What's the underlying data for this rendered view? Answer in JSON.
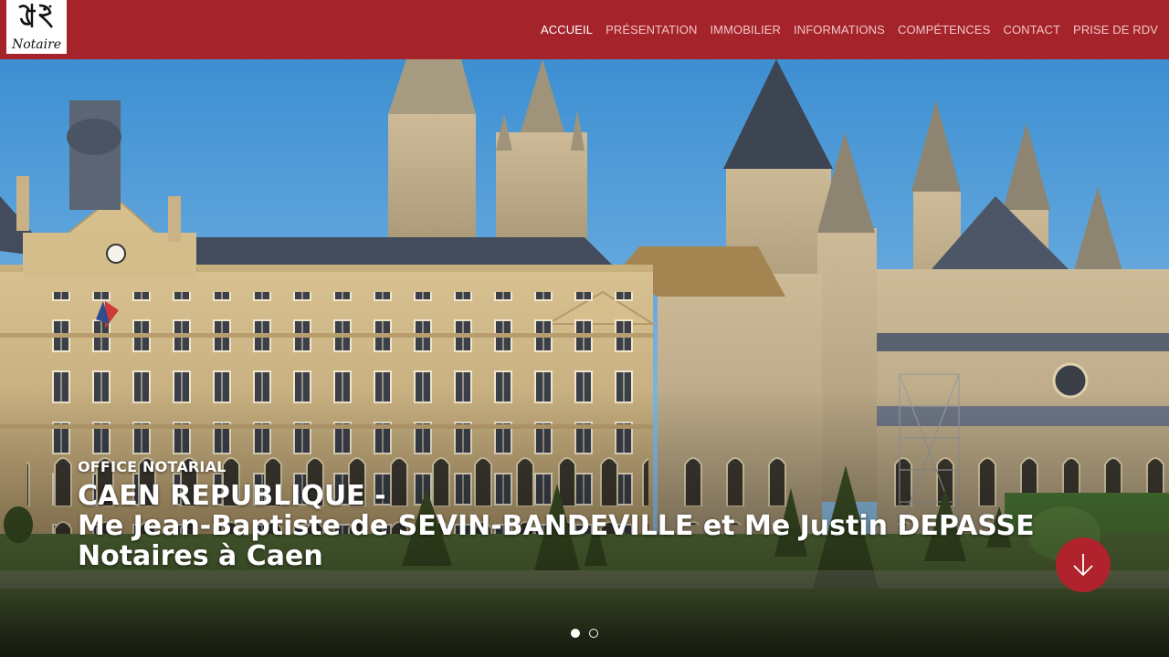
{
  "header": {
    "logo_text": "Notaire",
    "nav": [
      {
        "label": "ACCUEIL",
        "active": true
      },
      {
        "label": "PRÉSENTATION",
        "active": false
      },
      {
        "label": "IMMOBILIER",
        "active": false
      },
      {
        "label": "INFORMATIONS",
        "active": false
      },
      {
        "label": "COMPÉTENCES",
        "active": false
      },
      {
        "label": "CONTACT",
        "active": false
      },
      {
        "label": "PRISE DE RDV",
        "active": false
      }
    ]
  },
  "hero": {
    "eyebrow": "OFFICE NOTARIAL",
    "title_line1": "CAEN REPUBLIQUE -",
    "title_line2": "Me Jean-Baptiste de SEVIN-BANDEVILLE et Me Justin DEPASSE",
    "title_line3": "Notaires à Caen",
    "scroll_icon": "arrow-down-icon",
    "slides": 2,
    "active_slide": 1
  },
  "colors": {
    "brand": "#a5232a",
    "button": "#b0232c",
    "nav_text": "#f1c6c8",
    "nav_active": "#ffffff"
  }
}
